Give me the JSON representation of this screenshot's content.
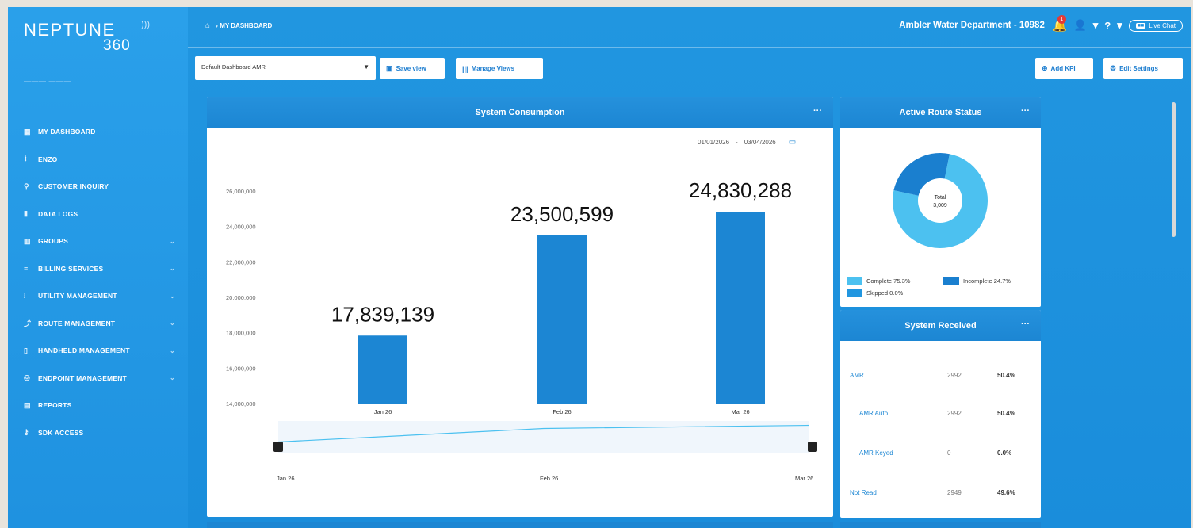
{
  "logo": {
    "main": "NEPTUNE",
    "sub": "360",
    "subtitle": "———  ———"
  },
  "breadcrumb": {
    "page": "MY DASHBOARD"
  },
  "header": {
    "department": "Ambler Water Department - 10982",
    "notification_count": "1",
    "live_chat": "Live Chat"
  },
  "sidebar": {
    "items": [
      {
        "icon": "dashboard-icon",
        "glyph": "▦",
        "label": "MY DASHBOARD",
        "chevron": false
      },
      {
        "icon": "enzo-icon",
        "glyph": "⌇",
        "label": "ENZO",
        "chevron": false
      },
      {
        "icon": "search-icon",
        "glyph": "⚲",
        "label": "CUSTOMER INQUIRY",
        "chevron": false
      },
      {
        "icon": "data-logs-icon",
        "glyph": "▮",
        "label": "DATA LOGS",
        "chevron": false
      },
      {
        "icon": "groups-icon",
        "glyph": "▥",
        "label": "GROUPS",
        "chevron": true
      },
      {
        "icon": "billing-icon",
        "glyph": "≡",
        "label": "BILLING SERVICES",
        "chevron": true
      },
      {
        "icon": "utility-icon",
        "glyph": "⦙",
        "label": "UTILITY MANAGEMENT",
        "chevron": true
      },
      {
        "icon": "route-icon",
        "glyph": "⤴",
        "label": "ROUTE MANAGEMENT",
        "chevron": true
      },
      {
        "icon": "handheld-icon",
        "glyph": "▯",
        "label": "HANDHELD MANAGEMENT",
        "chevron": true
      },
      {
        "icon": "endpoint-icon",
        "glyph": "◎",
        "label": "ENDPOINT MANAGEMENT",
        "chevron": true
      },
      {
        "icon": "reports-icon",
        "glyph": "▤",
        "label": "REPORTS",
        "chevron": false
      },
      {
        "icon": "sdk-icon",
        "glyph": "⚷",
        "label": "SDK ACCESS",
        "chevron": false
      }
    ]
  },
  "toolbar": {
    "view_select": "Default Dashboard AMR",
    "save_view": "Save view",
    "manage_views": "Manage Views",
    "add_kpi": "Add KPI",
    "edit_settings": "Edit Settings"
  },
  "consumption": {
    "title": "System Consumption",
    "more": "···",
    "date_from": "01/01/2026",
    "date_sep": "-",
    "date_to": "03/04/2026"
  },
  "route_status": {
    "title": "Active Route Status",
    "more": "···",
    "center_label": "Total",
    "center_value": "3,009",
    "legend": [
      {
        "label": "Complete 75.3%",
        "color": "#4cc1f0"
      },
      {
        "label": "Incomplete 24.7%",
        "color": "#1a7fcf"
      },
      {
        "label": "Skipped 0.0%",
        "color": "#2196e0"
      }
    ]
  },
  "received": {
    "title": "System Received",
    "more": "···",
    "rows": [
      {
        "label": "AMR",
        "count": "2992",
        "pct": "50.4%",
        "indent": false
      },
      {
        "label": "AMR Auto",
        "count": "2992",
        "pct": "50.4%",
        "indent": true
      },
      {
        "label": "AMR Keyed",
        "count": "0",
        "pct": "0.0%",
        "indent": true
      },
      {
        "label": "Not Read",
        "count": "2949",
        "pct": "49.6%",
        "indent": false
      }
    ]
  },
  "chart_data": {
    "type": "bar",
    "categories": [
      "Jan 26",
      "Feb 26",
      "Mar 26"
    ],
    "values": [
      17839139,
      23500599,
      24830288
    ],
    "data_labels": [
      "17,839,139",
      "23,500,599",
      "24,830,288"
    ],
    "y_ticks": [
      "14,000,000",
      "16,000,000",
      "18,000,000",
      "20,000,000",
      "22,000,000",
      "24,000,000",
      "26,000,000"
    ],
    "ylim": [
      14000000,
      26000000
    ],
    "navigator_labels": [
      "Jan 26",
      "Feb 26",
      "Mar 26"
    ],
    "bar_color": "#1c86d3"
  },
  "donut_data": {
    "type": "pie",
    "slices": [
      {
        "name": "Complete",
        "value": 75.3,
        "color": "#4cc1f0"
      },
      {
        "name": "Incomplete",
        "value": 24.7,
        "color": "#1a7fcf"
      },
      {
        "name": "Skipped",
        "value": 0.0,
        "color": "#2196e0"
      }
    ]
  }
}
